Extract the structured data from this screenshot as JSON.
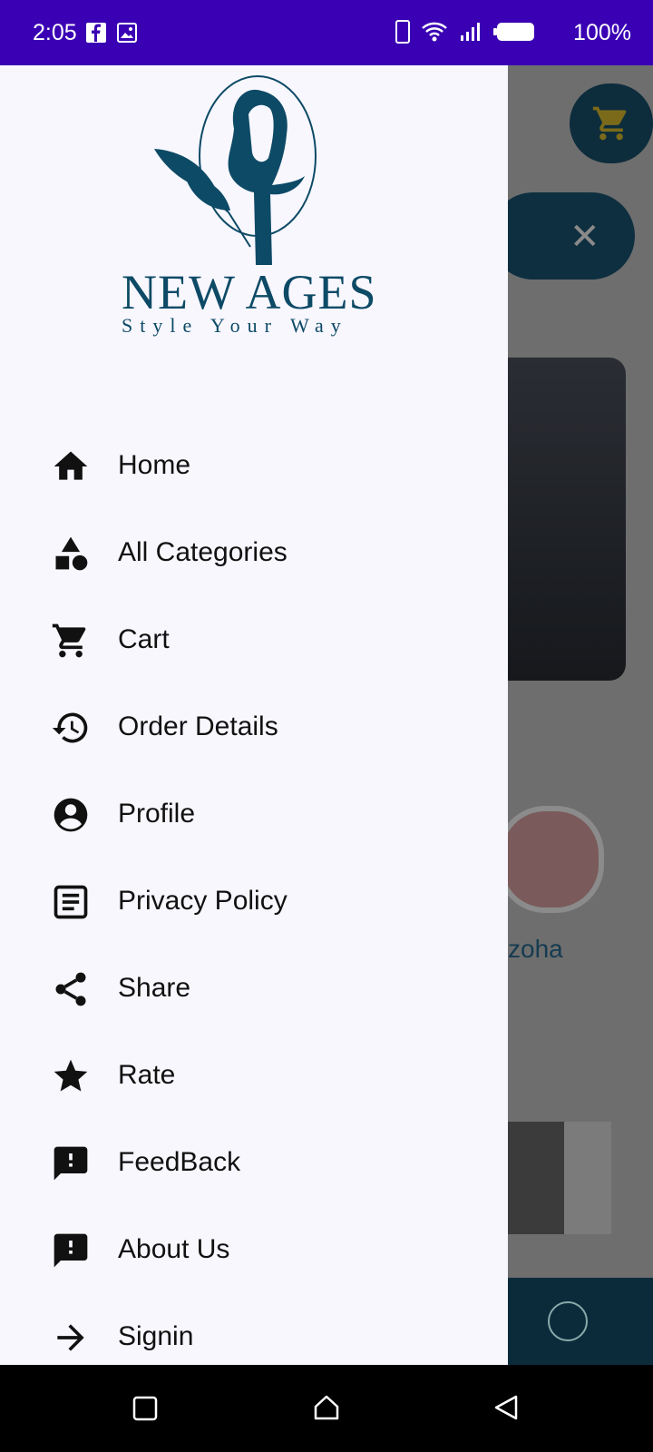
{
  "status_bar": {
    "time": "2:05",
    "battery": "100%",
    "left_icons": [
      "facebook-icon",
      "image-icon"
    ],
    "right_icons": [
      "phone-outline-icon",
      "wifi-icon",
      "signal-icon",
      "battery-icon"
    ]
  },
  "brand": {
    "name": "NEW AGES",
    "tagline": "Style Your Way",
    "color": "#0d4a66"
  },
  "menu": {
    "items": [
      {
        "label": "Home",
        "icon": "home-icon"
      },
      {
        "label": "All Categories",
        "icon": "categories-icon"
      },
      {
        "label": "Cart",
        "icon": "cart-icon"
      },
      {
        "label": "Order Details",
        "icon": "history-icon"
      },
      {
        "label": "Profile",
        "icon": "account-circle-icon"
      },
      {
        "label": "Privacy Policy",
        "icon": "document-icon"
      },
      {
        "label": "Share",
        "icon": "share-icon"
      },
      {
        "label": "Rate",
        "icon": "star-icon"
      },
      {
        "label": "FeedBack",
        "icon": "feedback-icon"
      },
      {
        "label": "About Us",
        "icon": "feedback-icon"
      },
      {
        "label": "Signin",
        "icon": "arrow-right-icon"
      }
    ]
  },
  "background": {
    "story_label": "zoha"
  },
  "colors": {
    "status_bar": "#3a00b4",
    "drawer_bg": "#f8f7fe",
    "accent_dark": "#0c2b3a"
  }
}
